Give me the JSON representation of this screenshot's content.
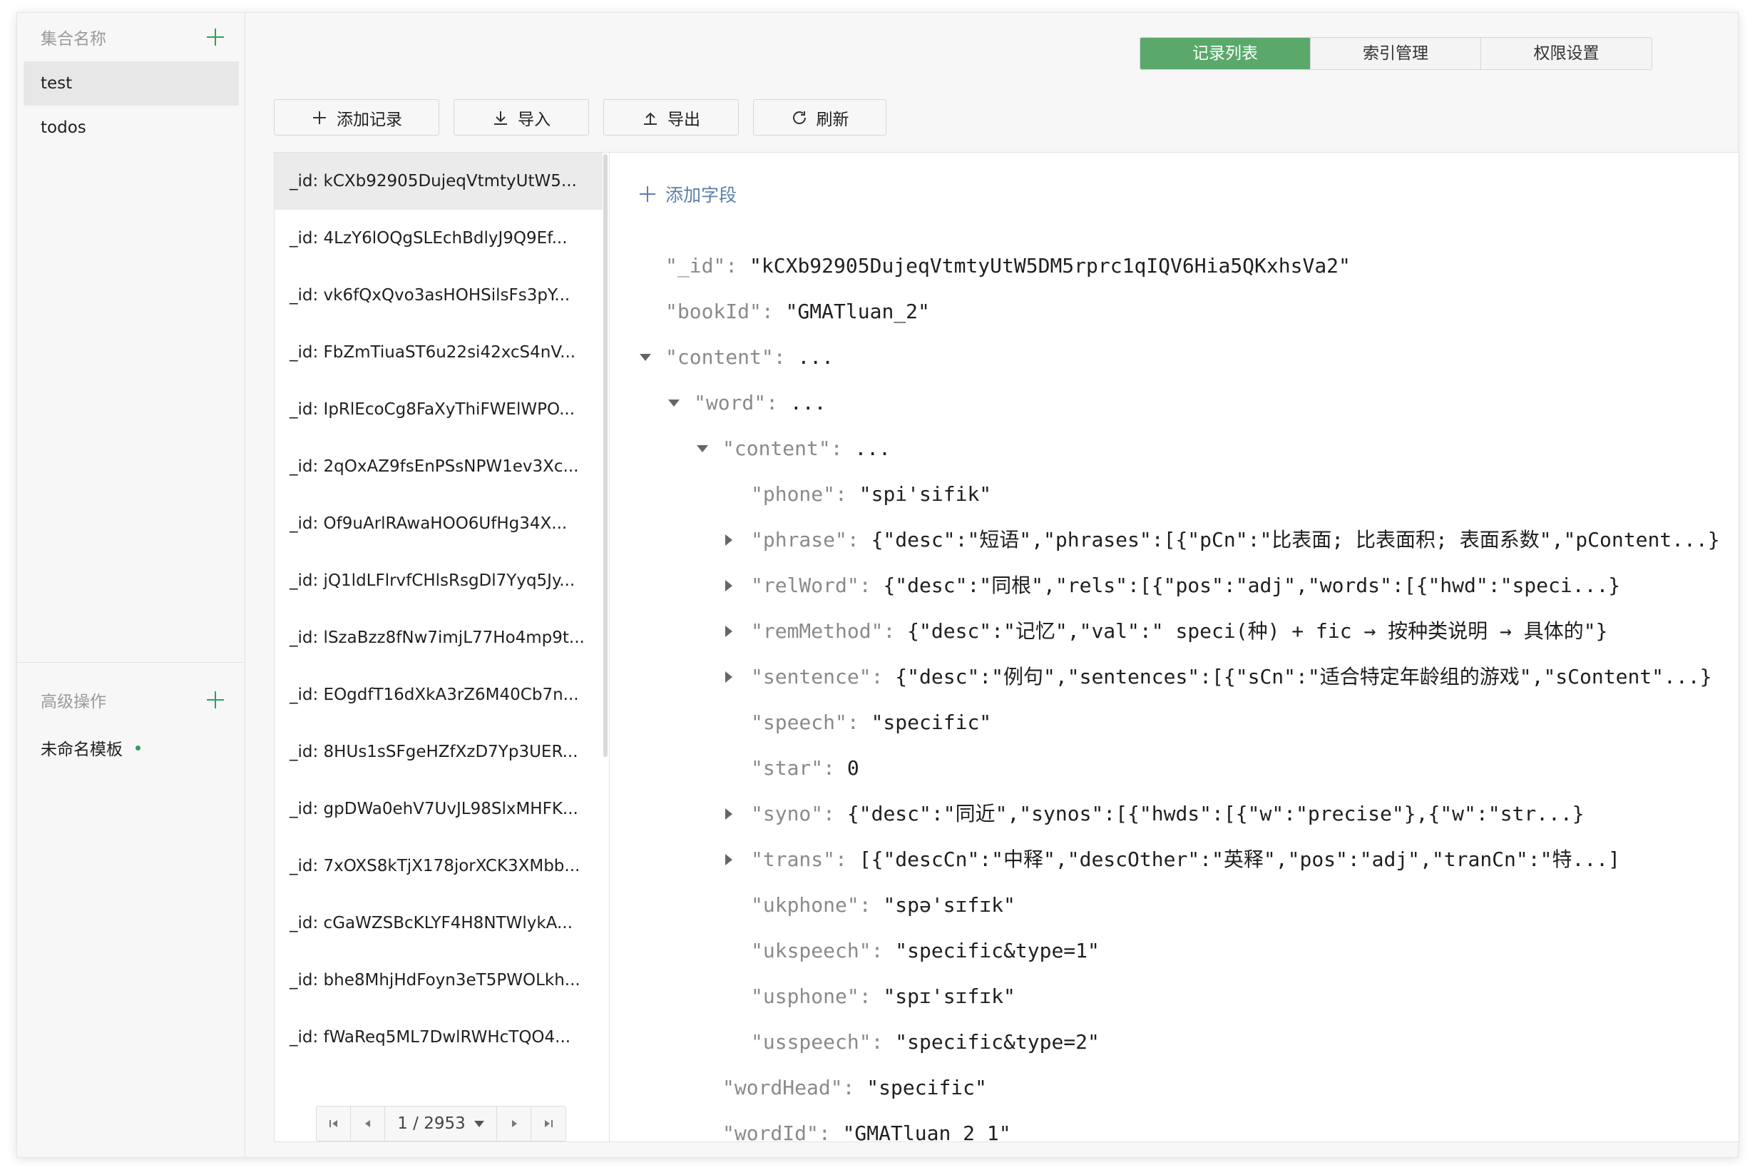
{
  "sidebar": {
    "collections_title": "集合名称",
    "collections": [
      {
        "label": "test",
        "active": true
      },
      {
        "label": "todos",
        "active": false
      }
    ],
    "advanced_title": "高级操作",
    "template_label": "未命名模板"
  },
  "tabs": [
    {
      "label": "记录列表",
      "active": true
    },
    {
      "label": "索引管理",
      "active": false
    },
    {
      "label": "权限设置",
      "active": false
    }
  ],
  "toolbar": {
    "add_label": "添加记录",
    "import_label": "导入",
    "export_label": "导出",
    "refresh_label": "刷新"
  },
  "records": [
    "_id: kCXb92905DujeqVtmtyUtW5...",
    "_id: 4LzY6lOQgSLEchBdlyJ9Q9Ef...",
    "_id: vk6fQxQvo3asHOHSilsFs3pY...",
    "_id: FbZmTiuaST6u22si42xcS4nV...",
    "_id: IpRlEcoCg8FaXyThiFWElWPO...",
    "_id: 2qOxAZ9fsEnPSsNPW1ev3Xc...",
    "_id: Of9uArlRAwaHOO6UfHg34X...",
    "_id: jQ1ldLFlrvfCHlsRsgDl7Yyq5Jy...",
    "_id: lSzaBzz8fNw7imjL77Ho4mp9t...",
    "_id: EOgdfT16dXkA3rZ6M40Cb7n...",
    "_id: 8HUs1sSFgeHZfXzD7Yp3UER...",
    "_id: gpDWa0ehV7UvJL98SlxMHFK...",
    "_id: 7xOXS8kTjX178jorXCK3XMbb...",
    "_id: cGaWZSBcKLYF4H8NTWlykA...",
    "_id: bhe8MhjHdFoyn3eT5PWOLkh...",
    "_id: fWaReq5ML7DwlRWHcTQO4..."
  ],
  "pager": {
    "label": "1 / 2953"
  },
  "detail": {
    "add_field_label": "添加字段",
    "rows": [
      {
        "indent": 0,
        "toggle": "none",
        "key": "\"_id\"",
        "value": "\"kCXb92905DujeqVtmtyUtW5DM5rprc1qIQV6Hia5QKxhsVa2\""
      },
      {
        "indent": 0,
        "toggle": "none",
        "key": "\"bookId\"",
        "value": "\"GMATluan_2\""
      },
      {
        "indent": 0,
        "toggle": "down",
        "key": "\"content\"",
        "value": "..."
      },
      {
        "indent": 1,
        "toggle": "down",
        "key": "\"word\"",
        "value": "..."
      },
      {
        "indent": 2,
        "toggle": "down",
        "key": "\"content\"",
        "value": "..."
      },
      {
        "indent": 3,
        "toggle": "none",
        "key": "\"phone\"",
        "value": "\"spi'sifik\""
      },
      {
        "indent": 3,
        "toggle": "right",
        "key": "\"phrase\"",
        "value": "{\"desc\":\"短语\",\"phrases\":[{\"pCn\":\"比表面; 比表面积; 表面系数\",\"pContent...}"
      },
      {
        "indent": 3,
        "toggle": "right",
        "key": "\"relWord\"",
        "value": "{\"desc\":\"同根\",\"rels\":[{\"pos\":\"adj\",\"words\":[{\"hwd\":\"speci...}"
      },
      {
        "indent": 3,
        "toggle": "right",
        "key": "\"remMethod\"",
        "value": "{\"desc\":\"记忆\",\"val\":\" speci(种) + fic → 按种类说明 → 具体的\"}"
      },
      {
        "indent": 3,
        "toggle": "right",
        "key": "\"sentence\"",
        "value": "{\"desc\":\"例句\",\"sentences\":[{\"sCn\":\"适合特定年龄组的游戏\",\"sContent\"...}"
      },
      {
        "indent": 3,
        "toggle": "none",
        "key": "\"speech\"",
        "value": "\"specific\""
      },
      {
        "indent": 3,
        "toggle": "none",
        "key": "\"star\"",
        "value": "0"
      },
      {
        "indent": 3,
        "toggle": "right",
        "key": "\"syno\"",
        "value": "{\"desc\":\"同近\",\"synos\":[{\"hwds\":[{\"w\":\"precise\"},{\"w\":\"str...}"
      },
      {
        "indent": 3,
        "toggle": "right",
        "key": "\"trans\"",
        "value": "[{\"descCn\":\"中释\",\"descOther\":\"英释\",\"pos\":\"adj\",\"tranCn\":\"特...]"
      },
      {
        "indent": 3,
        "toggle": "none",
        "key": "\"ukphone\"",
        "value": "\"spə'sɪfɪk\""
      },
      {
        "indent": 3,
        "toggle": "none",
        "key": "\"ukspeech\"",
        "value": "\"specific&type=1\""
      },
      {
        "indent": 3,
        "toggle": "none",
        "key": "\"usphone\"",
        "value": "\"spɪ'sɪfɪk\""
      },
      {
        "indent": 3,
        "toggle": "none",
        "key": "\"usspeech\"",
        "value": "\"specific&type=2\""
      },
      {
        "indent": 2,
        "toggle": "none",
        "key": "\"wordHead\"",
        "value": "\"specific\""
      },
      {
        "indent": 2,
        "toggle": "none",
        "key": "\"wordId\"",
        "value": "\"GMATluan_2_1\""
      }
    ]
  },
  "colors": {
    "accent": "#2aa35a",
    "tab_active": "#5aa96b",
    "link": "#5b7fa8",
    "key": "#8a8a8a"
  }
}
